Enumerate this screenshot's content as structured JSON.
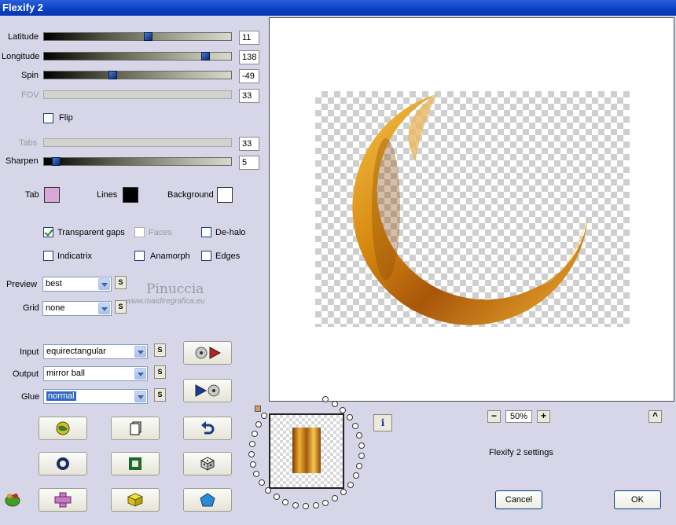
{
  "window": {
    "title": "Flexify 2"
  },
  "sliders": [
    {
      "label": "Latitude",
      "value": "11",
      "enabled": true
    },
    {
      "label": "Longitude",
      "value": "138",
      "enabled": true
    },
    {
      "label": "Spin",
      "value": "-49",
      "enabled": true
    },
    {
      "label": "FOV",
      "value": "33",
      "enabled": false
    }
  ],
  "flip": {
    "label": "Flip",
    "checked": false
  },
  "tabs_slider": {
    "label": "Tabs",
    "value": "33",
    "enabled": false
  },
  "sharpen": {
    "label": "Sharpen",
    "value": "5"
  },
  "colors": {
    "tab": {
      "label": "Tab",
      "color": "#d8a8d8"
    },
    "lines": {
      "label": "Lines",
      "color": "#000000"
    },
    "background": {
      "label": "Background",
      "color": "#ffffff"
    }
  },
  "options": {
    "transparent_gaps": {
      "label": "Transparent gaps",
      "checked": true
    },
    "faces": {
      "label": "Faces",
      "checked": false
    },
    "dehalo": {
      "label": "De-halo",
      "checked": false
    },
    "indicatrix": {
      "label": "Indicatrix",
      "checked": false
    },
    "anamorph": {
      "label": "Anamorph",
      "checked": false
    },
    "edges": {
      "label": "Edges",
      "checked": false
    }
  },
  "preview_select": {
    "label": "Preview",
    "value": "best"
  },
  "grid_select": {
    "label": "Grid",
    "value": "none"
  },
  "projection": {
    "input": {
      "label": "Input",
      "value": "equirectangular"
    },
    "output": {
      "label": "Output",
      "value": "mirror ball"
    },
    "glue": {
      "label": "Glue",
      "value": "normal"
    }
  },
  "s_button_label": "S",
  "watermark": {
    "name": "Pinuccia",
    "site": "www.maidiregrafica.eu"
  },
  "zoom": {
    "minus": "−",
    "value": "50%",
    "plus": "+"
  },
  "info_label": "i",
  "up_label": "^",
  "settings_label": "Flexify 2 settings",
  "buttons": {
    "cancel": "Cancel",
    "ok": "OK"
  },
  "icons": [
    "globe-icon",
    "copy-icon",
    "undo-icon",
    "ring-icon",
    "frame-icon",
    "dice-icon",
    "cross-icon",
    "cube-icon",
    "pentagon-icon",
    "disc-play-icon",
    "play-disc-icon",
    "frog-icon"
  ]
}
